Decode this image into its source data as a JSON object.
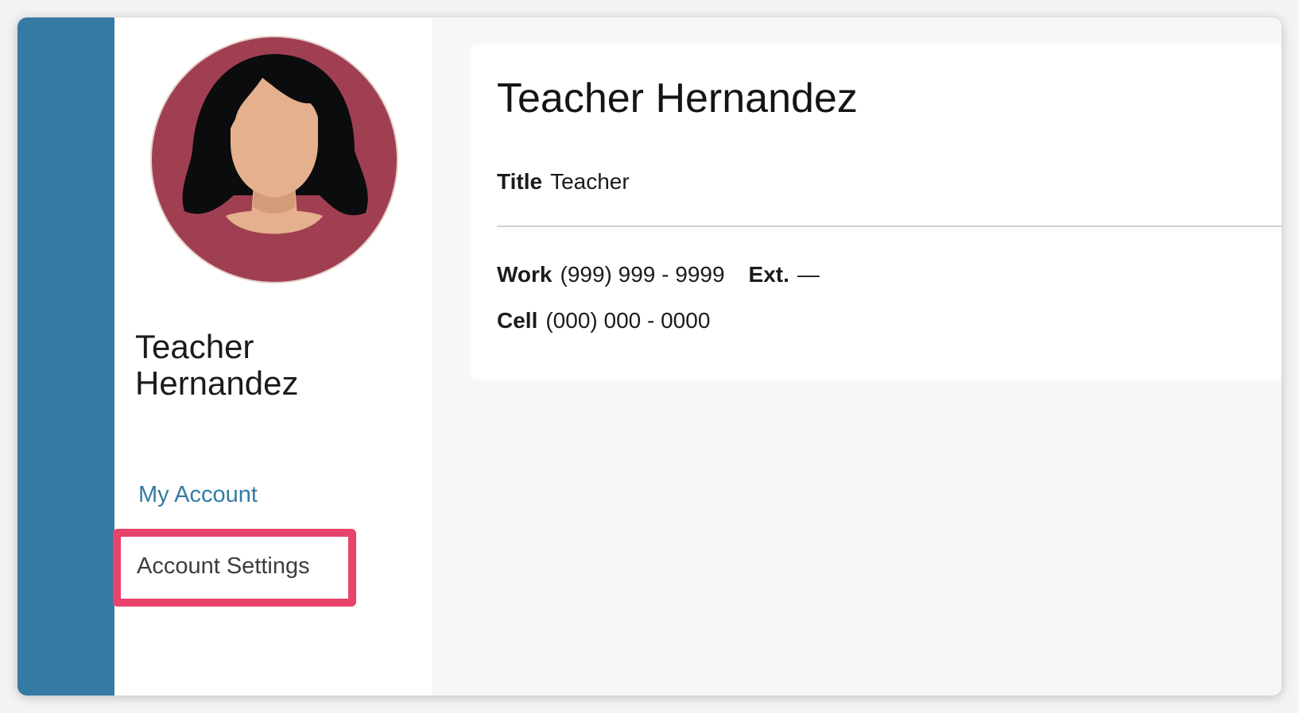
{
  "profile": {
    "name": "Teacher Hernandez",
    "name_line1": "Teacher",
    "name_line2": "Hernandez",
    "title_label": "Title",
    "title_value": "Teacher"
  },
  "contact": {
    "work_label": "Work",
    "work_value": "(999) 999 - 9999",
    "ext_label": "Ext.",
    "ext_value": "—",
    "cell_label": "Cell",
    "cell_value": "(000) 000 - 0000"
  },
  "sidebar": {
    "items": [
      {
        "label": "My Account"
      },
      {
        "label": "Account Settings"
      }
    ]
  },
  "colors": {
    "rail": "#357aa3",
    "link": "#357aa3",
    "highlight": "#e8436b",
    "avatar_bg": "#a13f52"
  },
  "icons": {
    "avatar": "female-user-avatar"
  }
}
